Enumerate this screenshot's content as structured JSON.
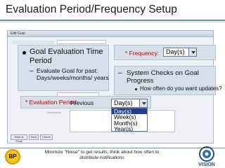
{
  "slide": {
    "title": "Evaluation Period/Frequency Setup"
  },
  "screenshot": {
    "window_title": "Edit Goal",
    "save_label": "Save & Close",
    "save_button_2": "Save",
    "cancel_label": "Cancel",
    "description_label": "Description"
  },
  "left_callout": {
    "bullet": "Goal Evaluation Time",
    "bullet_line2": "Period",
    "sub_bullet": "Evaluate Goal for past:",
    "sub_bullet_line2": "Days/weeks/months/ years"
  },
  "frequency": {
    "label": "* Frequency:",
    "selected": "Day(s)"
  },
  "right_callout": {
    "bullet": "System Checks on Goal",
    "bullet_line2": "Progress",
    "sub_bullet": "How often do you want updates?"
  },
  "evaluation": {
    "label": "* Evaluation Period:",
    "value": "Previous",
    "selected": "Day(s)",
    "options": [
      "Day(s)",
      "Week(s)",
      "Month(s)",
      "Year(s)"
    ]
  },
  "footer": {
    "badge": "BP",
    "text": "Minimize \"Noise\" to get results; think about how often to distribute notifications",
    "logo_text": "VISION"
  },
  "colors": {
    "accent": "#6b8fb5",
    "required": "#c00000",
    "selection": "#1f3f93",
    "badge": "#f5c518"
  }
}
